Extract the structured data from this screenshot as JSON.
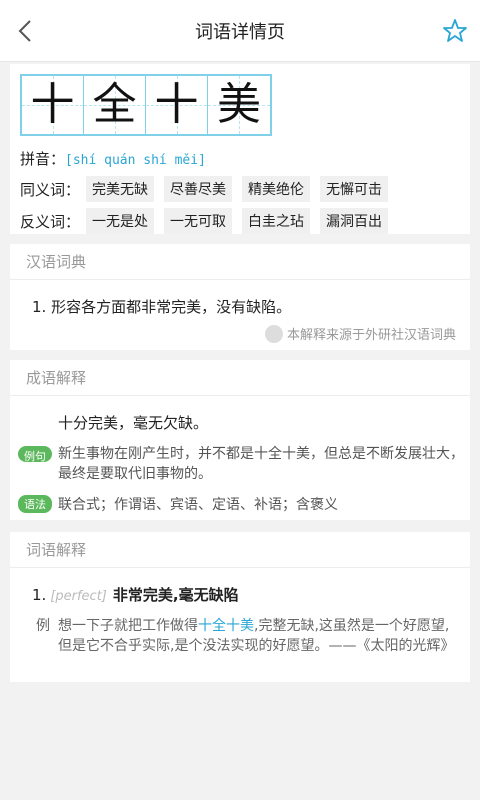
{
  "header": {
    "title": "词语详情页"
  },
  "word": {
    "chars": [
      "十",
      "全",
      "十",
      "美"
    ]
  },
  "pinyin": {
    "label": "拼音：",
    "value": "[shí quán shí měi]"
  },
  "synonyms": {
    "label": "同义词：",
    "items": [
      "完美无缺",
      "尽善尽美",
      "精美绝伦",
      "无懈可击"
    ]
  },
  "antonyms": {
    "label": "反义词：",
    "items": [
      "一无是处",
      "一无可取",
      "白圭之玷",
      "漏洞百出"
    ]
  },
  "dictionary": {
    "heading": "汉语词典",
    "definition": "1. 形容各方面都非常完美，没有缺陷。",
    "source": "本解释来源于外研社汉语词典"
  },
  "idiom": {
    "heading": "成语解释",
    "definition": "十分完美，毫无欠缺。",
    "example_badge": "例句",
    "example": "新生事物在刚产生时，并不都是十全十美，但总是不断发展壮大，最终是要取代旧事物的。",
    "grammar_badge": "语法",
    "grammar": "联合式；作谓语、宾语、定语、补语；含褒义"
  },
  "word_explain": {
    "heading": "词语解释",
    "number": "1.",
    "english": "[perfect]",
    "definition": "非常完美,毫无缺陷",
    "example_label": "例",
    "example_before": "想一下子就把工作做得",
    "example_highlight": "十全十美",
    "example_after": ",完整无缺,这虽然是一个好愿望,但是它不合乎实际,是个没法实现的好愿望。——《太阳的光辉》"
  },
  "colors": {
    "accent": "#2aa6d4",
    "badge": "#5cb85c",
    "grid": "#7fd0e8"
  }
}
